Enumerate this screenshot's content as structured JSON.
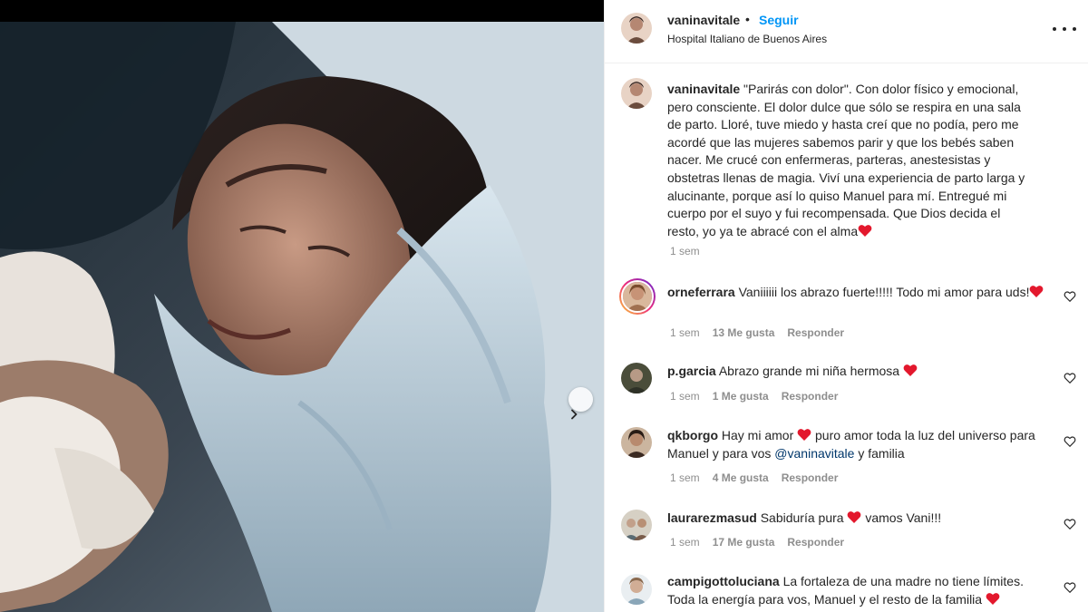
{
  "post": {
    "username": "vaninavitale",
    "dot": "•",
    "follow_label": "Seguir",
    "location": "Hospital Italiano de Buenos Aires",
    "more_icon": "more-horizontal-icon",
    "caption_text": "\"Parirás con dolor\". Con dolor físico y emocional, pero consciente. El dolor dulce que sólo se respira en una sala de parto. Lloré, tuve miedo y hasta creí que no podía, pero me acordé que las mujeres sabemos parir y que los bebés saben nacer. Me crucé con enfermeras, parteras, anestesistas y obstetras llenas de magia. Viví una experiencia de parto larga y alucinante, porque así lo quiso Manuel para mí. Entregué mi cuerpo por el suyo y fui recompensada. Que Dios decida el resto, yo ya te abracé con el alma",
    "caption_time": "1 sem"
  },
  "colors": {
    "heart": "#e3182d",
    "follow": "#0095f6",
    "meta": "#8e8e8e",
    "story_ring": "#d6249f"
  },
  "comments": [
    {
      "username": "orneferrara",
      "text_1": "Vaniiiiii los abrazo fuerte!!!!! Todo mi amor para uds!",
      "text_2": "",
      "mention": "",
      "text_3": "",
      "time": "1 sem",
      "likes": "13 Me gusta",
      "reply": "Responder"
    },
    {
      "username": "p.garcia",
      "text_1": "Abrazo grande mi niña hermosa ",
      "text_2": "",
      "mention": "",
      "text_3": "",
      "time": "1 sem",
      "likes": "1 Me gusta",
      "reply": "Responder"
    },
    {
      "username": "qkborgo",
      "text_1": "Hay mi amor ",
      "text_2": " puro amor toda la luz del universo para Manuel y para vos ",
      "mention": "@vaninavitale",
      "text_3": " y familia",
      "time": "1 sem",
      "likes": "4 Me gusta",
      "reply": "Responder"
    },
    {
      "username": "laurarezmasud",
      "text_1": "Sabiduría pura ",
      "text_2": " vamos Vani!!!",
      "mention": "",
      "text_3": "",
      "time": "1 sem",
      "likes": "17 Me gusta",
      "reply": "Responder"
    },
    {
      "username": "campigottoluciana",
      "text_1": "La fortaleza de una madre no tiene límites. Toda la energía para vos, Manuel y el resto de la familia ",
      "text_2": "",
      "mention": "",
      "text_3": "",
      "time": "",
      "likes": "",
      "reply": ""
    }
  ],
  "photo": {
    "next_icon": "chevron-right-icon"
  }
}
